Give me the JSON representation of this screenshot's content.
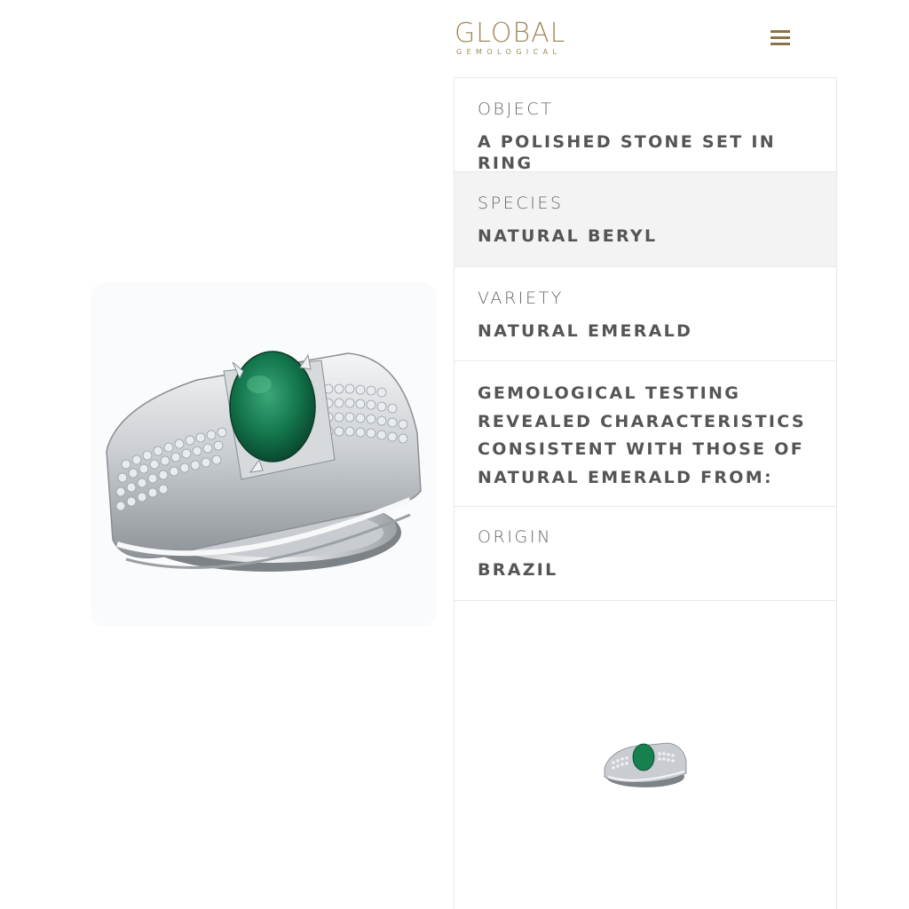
{
  "header": {
    "logo_text": "GLOBAL",
    "logo_subtext": "GEMOLOGICAL",
    "menu_icon": "hamburger-menu-icon",
    "brand_color": "#a08a5a"
  },
  "product": {
    "image_icon": "emerald-ring-photo",
    "thumbnail_icon": "emerald-ring-thumbnail"
  },
  "specs": {
    "object": {
      "label": "OBJECT",
      "value": "A POLISHED STONE SET IN RING"
    },
    "species": {
      "label": "SPECIES",
      "value": "NATURAL BERYL"
    },
    "variety": {
      "label": "VARIETY",
      "value": "NATURAL EMERALD"
    },
    "testing": {
      "value": "GEMOLOGICAL TESTING REVEALED CHARACTERISTICS CONSISTENT WITH THOSE OF NATURAL EMERALD FROM:"
    },
    "origin": {
      "label": "ORIGIN",
      "value": "BRAZIL"
    }
  }
}
